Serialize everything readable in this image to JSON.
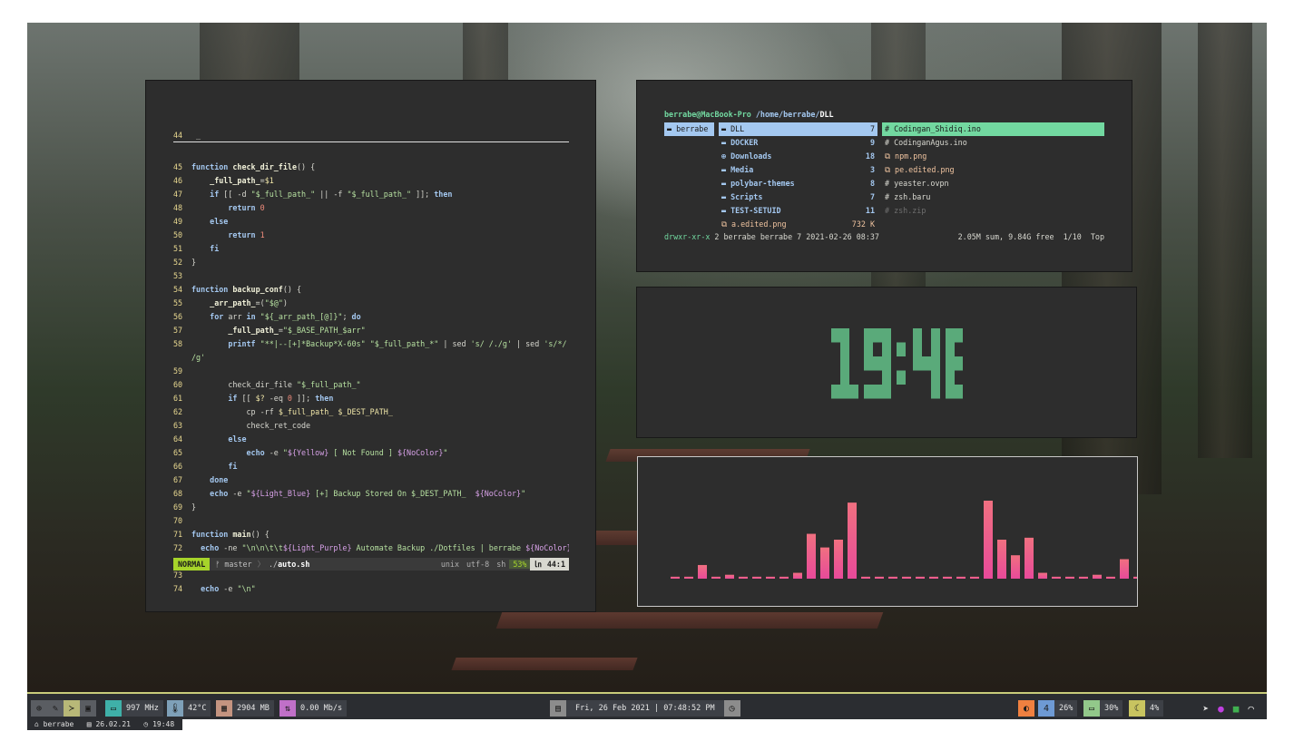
{
  "editor": {
    "cursor_line": {
      "no": "44",
      "text": " _"
    },
    "lines": [
      {
        "no": "45",
        "html": "<span class='kw'>function</span> <span class='fn'>check_dir_file</span>() {"
      },
      {
        "no": "46",
        "html": "    <span class='fn'>_full_path_</span>=<span class='var'>$1</span>"
      },
      {
        "no": "47",
        "html": "    <span class='kw'>if</span> [[ -d <span class='str'>\"$_full_path_\"</span> || -f <span class='str'>\"$_full_path_\"</span> ]]; <span class='kw'>then</span>"
      },
      {
        "no": "48",
        "html": "        <span class='kw'>return</span> <span class='num'>0</span>"
      },
      {
        "no": "49",
        "html": "    <span class='kw'>else</span>"
      },
      {
        "no": "50",
        "html": "        <span class='kw'>return</span> <span class='num'>1</span>"
      },
      {
        "no": "51",
        "html": "    <span class='kw'>fi</span>"
      },
      {
        "no": "52",
        "html": "}"
      },
      {
        "no": "53",
        "html": ""
      },
      {
        "no": "54",
        "html": "<span class='kw'>function</span> <span class='fn'>backup_conf</span>() {"
      },
      {
        "no": "55",
        "html": "    <span class='fn'>_arr_path_</span>=(<span class='str'>\"$@\"</span>)"
      },
      {
        "no": "56",
        "html": "    <span class='kw'>for</span> arr <span class='kw'>in</span> <span class='str'>\"${_arr_path_[@]}\"</span>; <span class='kw'>do</span>"
      },
      {
        "no": "57",
        "html": "        <span class='fn'>_full_path_</span>=<span class='str'>\"$_BASE_PATH_$arr\"</span>"
      },
      {
        "no": "58",
        "html": "        <span class='kw'>printf</span> <span class='str'>\"**|--[+]*Backup*X-60s\"</span> <span class='str'>\"$_full_path_*\"</span> | sed <span class='str'>'s/ /./g'</span> | sed <span class='str'>'s/*/</span>"
      },
      {
        "no": "",
        "html": "<span class='str'>/g'</span>"
      },
      {
        "no": "59",
        "html": ""
      },
      {
        "no": "60",
        "html": "        check_dir_file <span class='str'>\"$_full_path_\"</span>"
      },
      {
        "no": "61",
        "html": "        <span class='kw'>if</span> [[ <span class='var'>$?</span> -eq <span class='num'>0</span> ]]; <span class='kw'>then</span>"
      },
      {
        "no": "62",
        "html": "            cp -rf <span class='var'>$_full_path_ $_DEST_PATH_</span>"
      },
      {
        "no": "63",
        "html": "            check_ret_code"
      },
      {
        "no": "64",
        "html": "        <span class='kw'>else</span>"
      },
      {
        "no": "65",
        "html": "            <span class='kw'>echo</span> -e <span class='str'>\"</span><span class='cmt'>${Yellow}</span><span class='str'> [ Not Found ] </span><span class='cmt'>${NoColor}</span><span class='str'>\"</span>"
      },
      {
        "no": "66",
        "html": "        <span class='kw'>fi</span>"
      },
      {
        "no": "67",
        "html": "    <span class='kw'>done</span>"
      },
      {
        "no": "68",
        "html": "    <span class='kw'>echo</span> -e <span class='str'>\"</span><span class='cmt'>${Light_Blue}</span><span class='str'> [+] Backup Stored On $_DEST_PATH_  </span><span class='cmt'>${NoColor}</span><span class='str'>\"</span>"
      },
      {
        "no": "69",
        "html": "}"
      },
      {
        "no": "70",
        "html": ""
      },
      {
        "no": "71",
        "html": "<span class='kw'>function</span> <span class='fn'>main</span>() {"
      },
      {
        "no": "72",
        "html": "  <span class='kw'>echo</span> -ne <span class='str'>\"\\n\\n\\t\\t</span><span class='cmt'>${Light_Purple}</span><span class='str'> Automate Backup ./Dotfiles | berrabe </span><span class='cmt'>${NoColor}</span>"
      },
      {
        "no": "",
        "html": "<span class='str'>\"</span>"
      },
      {
        "no": "73",
        "html": ""
      },
      {
        "no": "74",
        "html": "  <span class='kw'>echo</span> -e <span class='str'>\"\\n\"</span>"
      }
    ],
    "status": {
      "mode": "NORMAL",
      "branch": "ᚠ master",
      "path_sep": "〉",
      "dir": "./",
      "file": "auto.sh",
      "format": "unix",
      "encoding": "utf-8",
      "filetype": "sh",
      "percent": "53%",
      "position": "44:1",
      "pos_icon": "㏑"
    }
  },
  "filemanager": {
    "prompt_user": "berrabe@MacBook-Pro",
    "prompt_path": "/home/berrabe/",
    "prompt_cwd": "DLL",
    "parent": [
      {
        "name": "berrabe"
      }
    ],
    "dirs": [
      {
        "icon": "▬",
        "name": "DLL",
        "count": "7"
      },
      {
        "icon": "▬",
        "name": "DOCKER",
        "count": "9"
      },
      {
        "icon": "⊕",
        "name": "Downloads",
        "count": "18"
      },
      {
        "icon": "▬",
        "name": "Media",
        "count": "3"
      },
      {
        "icon": "▬",
        "name": "polybar-themes",
        "count": "8"
      },
      {
        "icon": "▬",
        "name": "Scripts",
        "count": "7"
      },
      {
        "icon": "▬",
        "name": "TEST-SETUID",
        "count": "11"
      },
      {
        "icon": "⧉",
        "name": "a.edited.png",
        "count": "732 K",
        "kind": "img"
      }
    ],
    "files": [
      {
        "icon": "#",
        "name": "Codingan_Shidiq.ino",
        "kind": "sel"
      },
      {
        "icon": "#",
        "name": "CodinganAgus.ino",
        "kind": "file"
      },
      {
        "icon": "⧉",
        "name": "npm.png",
        "kind": "img"
      },
      {
        "icon": "⧉",
        "name": "pe.edited.png",
        "kind": "img"
      },
      {
        "icon": "#",
        "name": "yeaster.ovpn",
        "kind": "file"
      },
      {
        "icon": "#",
        "name": "zsh.baru",
        "kind": "file"
      },
      {
        "icon": "#",
        "name": "zsh.zip",
        "kind": "dim"
      }
    ],
    "status_perm": "drwxr-xr-x",
    "status_info": "2 berrabe berrabe 7 2021-02-26 08:37",
    "status_right": "2.05M sum, 9.84G free  1/10  Top"
  },
  "clock": {
    "time": "19:48",
    "color": "#5aaa7a"
  },
  "visualizer": {
    "values": [
      1,
      1,
      7,
      1,
      2,
      1,
      1,
      1,
      1,
      3,
      23,
      16,
      20,
      39,
      1,
      1,
      1,
      1,
      1,
      1,
      1,
      1,
      1,
      40,
      20,
      12,
      21,
      3,
      1,
      1,
      1,
      2,
      1,
      10,
      1,
      1
    ],
    "max": 40,
    "color_top": "#f07080",
    "color_bottom": "#e84a9a"
  },
  "bar": {
    "ws_icons": [
      "globe-icon",
      "edit-icon",
      "terminal-icon",
      "image-icon"
    ],
    "cpu": "997 MHz",
    "temp": "42°C",
    "mem": "2904 MB",
    "net": "0.00 Mb/s",
    "date": "Fri, 26 Feb 2021",
    "sep": "|",
    "time": "07:48:52 PM",
    "brightness": "4",
    "volume": "26%",
    "battery": "30%",
    "night": "4%",
    "colors": {
      "cpu": "#3fb0a8",
      "temp": "#7ea0b8",
      "mem": "#c49480",
      "net": "#c070c8",
      "date": "#8c8c8c",
      "bright": "#f08040",
      "vol": "#6e9ad4",
      "bat": "#92c88a",
      "night": "#c8c460",
      "accent": "#c8cc7a"
    }
  },
  "strip": {
    "user": "berrabe",
    "date": "26.02.21",
    "time": "19:48"
  }
}
